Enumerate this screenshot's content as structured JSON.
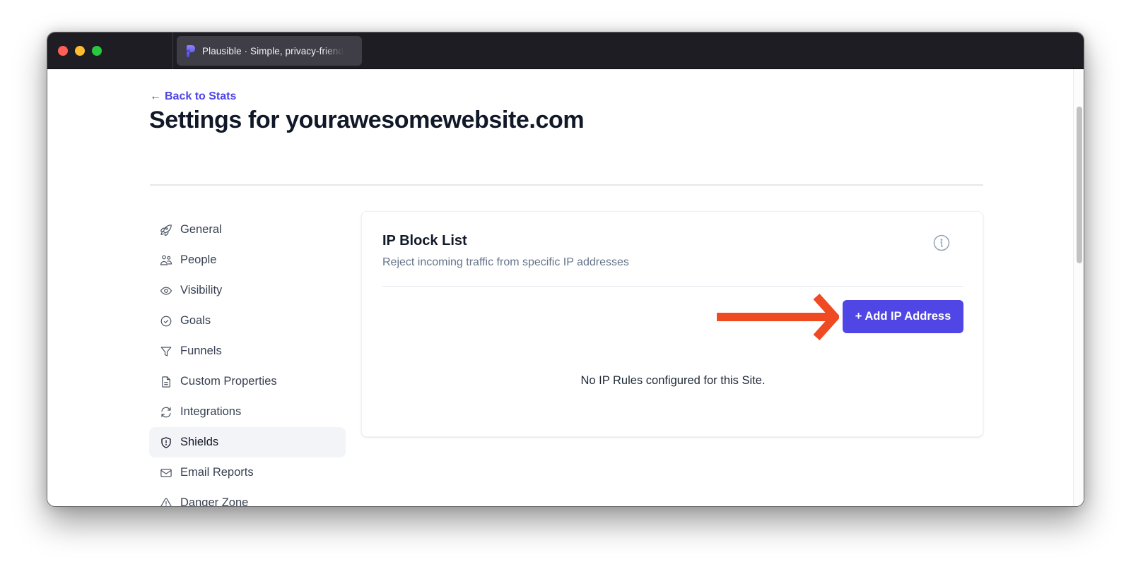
{
  "browser": {
    "tab": {
      "title": "Plausible · Simple, privacy-friendly analytics",
      "favicon": "plausible-logo"
    },
    "traffic_lights": [
      "close",
      "minimize",
      "zoom"
    ]
  },
  "page": {
    "back_link": {
      "arrow": "←",
      "label": "Back to Stats"
    },
    "title": "Settings for yourawesomewebsite.com"
  },
  "sidebar": {
    "items": [
      {
        "label": "General",
        "icon": "rocket-icon",
        "active": false
      },
      {
        "label": "People",
        "icon": "users-icon",
        "active": false
      },
      {
        "label": "Visibility",
        "icon": "eye-icon",
        "active": false
      },
      {
        "label": "Goals",
        "icon": "check-circle-icon",
        "active": false
      },
      {
        "label": "Funnels",
        "icon": "funnel-icon",
        "active": false
      },
      {
        "label": "Custom Properties",
        "icon": "document-icon",
        "active": false
      },
      {
        "label": "Integrations",
        "icon": "refresh-icon",
        "active": false
      },
      {
        "label": "Shields",
        "icon": "shield-exclamation-icon",
        "active": true
      },
      {
        "label": "Email Reports",
        "icon": "envelope-icon",
        "active": false
      },
      {
        "label": "Danger Zone",
        "icon": "warning-triangle-icon",
        "active": false
      }
    ]
  },
  "card": {
    "title": "IP Block List",
    "subtitle": "Reject incoming traffic from specific IP addresses",
    "info_icon": "info-circle-icon",
    "add_button_label": "+ Add IP Address",
    "empty_message": "No IP Rules configured for this Site."
  },
  "annotation": {
    "type": "arrow",
    "points_to": "add-ip-address-button",
    "color": "#f04a23"
  },
  "colors": {
    "accent": "#4f46e5",
    "titlebar": "#1e1d23",
    "tab": "#3f3e47"
  }
}
